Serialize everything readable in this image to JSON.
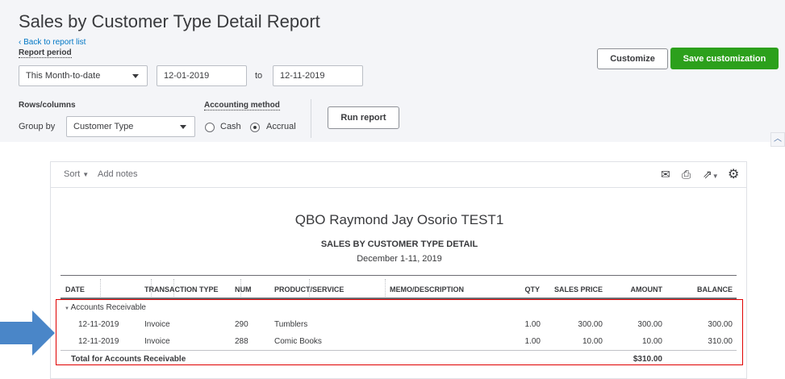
{
  "header": {
    "title": "Sales by Customer Type Detail Report",
    "back_link": "Back to report list"
  },
  "period": {
    "label": "Report period",
    "preset": "This Month-to-date",
    "from": "12-01-2019",
    "to_label": "to",
    "to": "12-11-2019"
  },
  "rows_columns": {
    "label": "Rows/columns",
    "group_by_label": "Group by",
    "group_by": "Customer Type"
  },
  "accounting": {
    "label": "Accounting method",
    "cash": "Cash",
    "accrual": "Accrual",
    "selected": "Accrual"
  },
  "buttons": {
    "run": "Run report",
    "customize": "Customize",
    "save": "Save customization"
  },
  "toolbar": {
    "sort": "Sort",
    "add_notes": "Add notes"
  },
  "report": {
    "company": "QBO Raymond Jay Osorio TEST1",
    "title": "SALES BY CUSTOMER TYPE DETAIL",
    "date_range": "December 1-11, 2019",
    "columns": [
      "DATE",
      "TRANSACTION TYPE",
      "NUM",
      "PRODUCT/SERVICE",
      "MEMO/DESCRIPTION",
      "QTY",
      "SALES PRICE",
      "AMOUNT",
      "BALANCE"
    ],
    "group": "Accounts Receivable",
    "rows": [
      {
        "date": "12-11-2019",
        "type": "Invoice",
        "num": "290",
        "product": "Tumblers",
        "memo": "",
        "qty": "1.00",
        "price": "300.00",
        "amount": "300.00",
        "balance": "300.00"
      },
      {
        "date": "12-11-2019",
        "type": "Invoice",
        "num": "288",
        "product": "Comic Books",
        "memo": "",
        "qty": "1.00",
        "price": "10.00",
        "amount": "10.00",
        "balance": "310.00"
      }
    ],
    "total_label": "Total for Accounts Receivable",
    "total_amount": "$310.00"
  },
  "colors": {
    "accent_green": "#2ca01c",
    "link_blue": "#0077c5",
    "highlight_red": "#e00000",
    "arrow_blue": "#4a86c8"
  }
}
